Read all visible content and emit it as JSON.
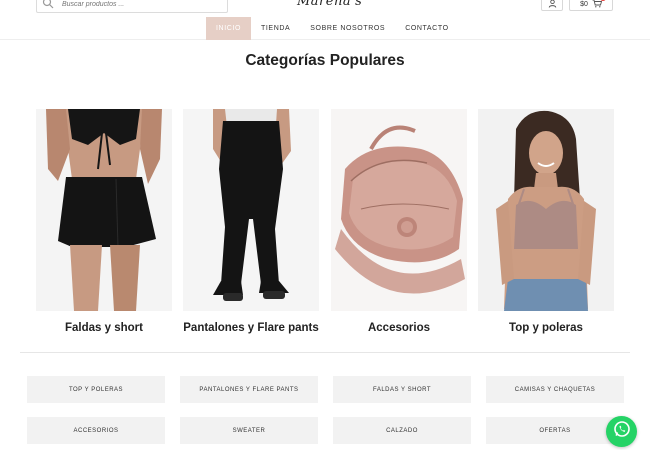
{
  "header": {
    "search": {
      "placeholder": "Buscar productos ..."
    },
    "logo_text": "Marena's",
    "cart": {
      "total": "$0"
    }
  },
  "nav": {
    "items": [
      {
        "label": "INICIO",
        "active": true
      },
      {
        "label": "TIENDA",
        "active": false
      },
      {
        "label": "SOBRE NOSOTROS",
        "active": false
      },
      {
        "label": "CONTACTO",
        "active": false
      }
    ]
  },
  "popular": {
    "title": "Categorías Populares",
    "categories": [
      {
        "label": "Faldas y short"
      },
      {
        "label": "Pantalones y Flare pants"
      },
      {
        "label": "Accesorios"
      },
      {
        "label": "Top y poleras"
      }
    ]
  },
  "tags": [
    "TOP Y POLERAS",
    "PANTALONES Y FLARE PANTS",
    "FALDAS Y SHORT",
    "CAMISAS Y CHAQUETAS",
    "ACCESORIOS",
    "SWEATER",
    "CALZADO",
    "OFERTAS"
  ],
  "colors": {
    "nav_active_bg": "#e6cfc6",
    "tag_bg": "#f2f2f2",
    "whatsapp": "#25d366",
    "cart_badge": "#e53935"
  },
  "icons": [
    "search-icon",
    "user-icon",
    "cart-icon",
    "whatsapp-icon"
  ]
}
